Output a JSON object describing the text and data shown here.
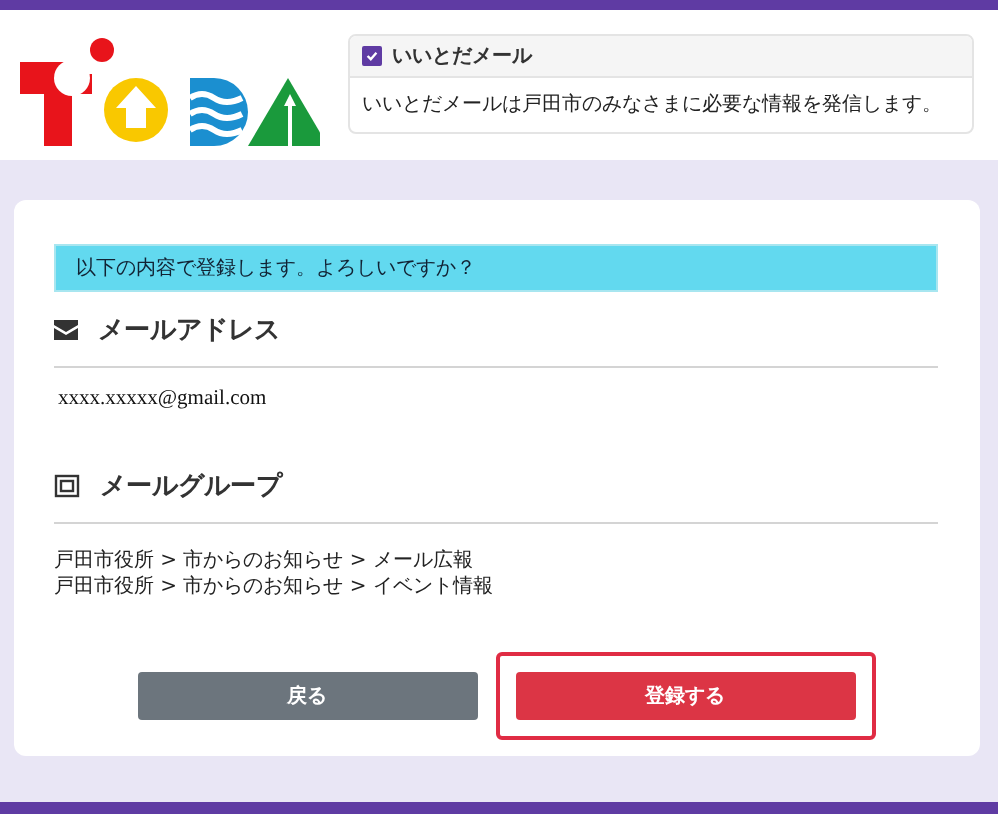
{
  "header": {
    "info_box": {
      "title": "いいとだメール",
      "checked": true,
      "body": "いいとだメールは戸田市のみなさまに必要な情報を発信します。"
    }
  },
  "confirm": {
    "alert": "以下の内容で登録します。よろしいですか？",
    "sections": [
      {
        "kind": "email",
        "heading": "メールアドレス",
        "lines": [
          "xxxx.xxxxx@gmail.com"
        ]
      },
      {
        "kind": "group",
        "heading": "メールグループ",
        "lines": [
          "戸田市役所 > 市からのお知らせ > メール広報",
          "戸田市役所 > 市からのお知らせ > イベント情報"
        ]
      }
    ],
    "buttons": [
      {
        "kind": "back",
        "label": "戻る",
        "focused": false
      },
      {
        "kind": "submit",
        "label": "登録する",
        "focused": true
      }
    ]
  }
}
